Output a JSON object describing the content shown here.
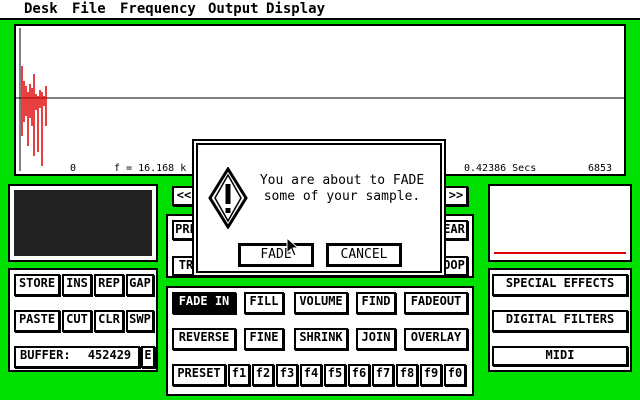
{
  "menu": [
    "Desk",
    "File",
    "Frequency",
    "Output",
    "Display"
  ],
  "wave": {
    "start": "0",
    "freq": "f = 16.168 k",
    "secs": "0.42386 Secs",
    "end": "6853"
  },
  "nav": {
    "left": "<<",
    "right": ">>"
  },
  "partial": {
    "pre": "PRE",
    "tr": "TR",
    "ear": "EAR",
    "oop": "OOP"
  },
  "left_group": {
    "row1": [
      "STORE",
      "INS",
      "REP",
      "GAP"
    ],
    "row2": [
      "PASTE",
      "CUT",
      "CLR",
      "SWP"
    ],
    "buffer_label": "BUFFER:",
    "buffer_value": "452429",
    "e": "E"
  },
  "center_group": {
    "row1": [
      "FADE IN",
      "FILL",
      "VOLUME",
      "FIND",
      "FADEOUT"
    ],
    "row2": [
      "REVERSE",
      "FINE",
      "SHRINK",
      "JOIN",
      "OVERLAY"
    ],
    "preset": "PRESET",
    "fkeys": [
      "f1",
      "f2",
      "f3",
      "f4",
      "f5",
      "f6",
      "f7",
      "f8",
      "f9",
      "f0"
    ]
  },
  "right_group": [
    "SPECIAL EFFECTS",
    "DIGITAL FILTERS",
    "MIDI"
  ],
  "dialog": {
    "message": "You are about to FADE\nsome of your sample.",
    "ok": "FADE",
    "cancel": "CANCEL"
  },
  "colors": {
    "background": "#00e000",
    "wave": "#e00000"
  }
}
